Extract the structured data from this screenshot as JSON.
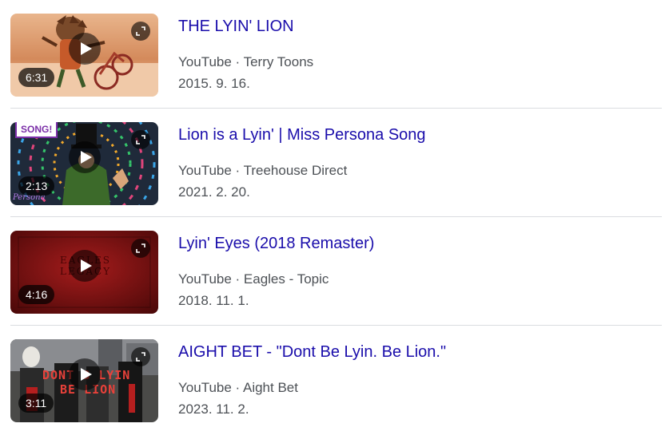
{
  "results": [
    {
      "title": "THE LYIN' LION",
      "source": "YouTube · Terry Toons",
      "date": "2015. 9. 16.",
      "duration": "6:31",
      "thumbnail_colors": [
        "#f2c7a4",
        "#d98b5f"
      ]
    },
    {
      "title": "Lion is a Lyin' | Miss Persona Song",
      "source": "YouTube · Treehouse Direct",
      "date": "2021. 2. 20.",
      "duration": "2:13",
      "badge": "SONG!",
      "thumbnail_colors": [
        "#1c3a2a",
        "#3b2a5a"
      ]
    },
    {
      "title": "Lyin' Eyes (2018 Remaster)",
      "source": "YouTube · Eagles - Topic",
      "date": "2018. 11. 1.",
      "duration": "4:16",
      "thumbnail_colors": [
        "#8b1414",
        "#5e0a0a"
      ]
    },
    {
      "title": "AIGHT BET - \"Dont Be Lyin. Be Lion.\"",
      "source": "YouTube · Aight Bet",
      "date": "2023. 11. 2.",
      "duration": "3:11",
      "thumbnail_colors": [
        "#3a3a3a",
        "#1a1a1a"
      ]
    }
  ],
  "icons": {
    "play": "play-icon",
    "expand": "expand-icon"
  },
  "colors": {
    "title_link": "#1a0dab",
    "meta_text": "#4d5156",
    "divider": "#dadce0"
  }
}
